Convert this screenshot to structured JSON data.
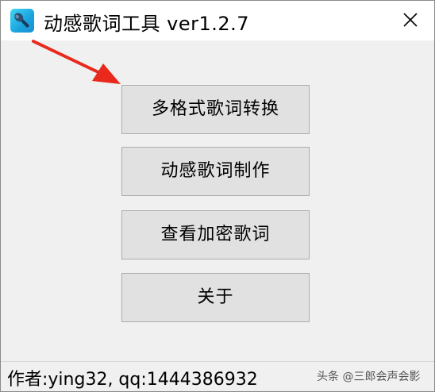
{
  "window": {
    "title": "动感歌词工具 ver1.2.7",
    "close_icon": "close-icon",
    "app_icon": "microphone-icon"
  },
  "buttons": [
    {
      "label": "多格式歌词转换"
    },
    {
      "label": "动感歌词制作"
    },
    {
      "label": "查看加密歌词"
    },
    {
      "label": "关于"
    }
  ],
  "status": {
    "author": "作者:ying32, qq:1444386932"
  },
  "watermark": "头条 @三郎会声会影",
  "colors": {
    "annotation_arrow": "#e8291c",
    "button_face": "#e1e1e1",
    "window_bg": "#f0f0f0"
  }
}
